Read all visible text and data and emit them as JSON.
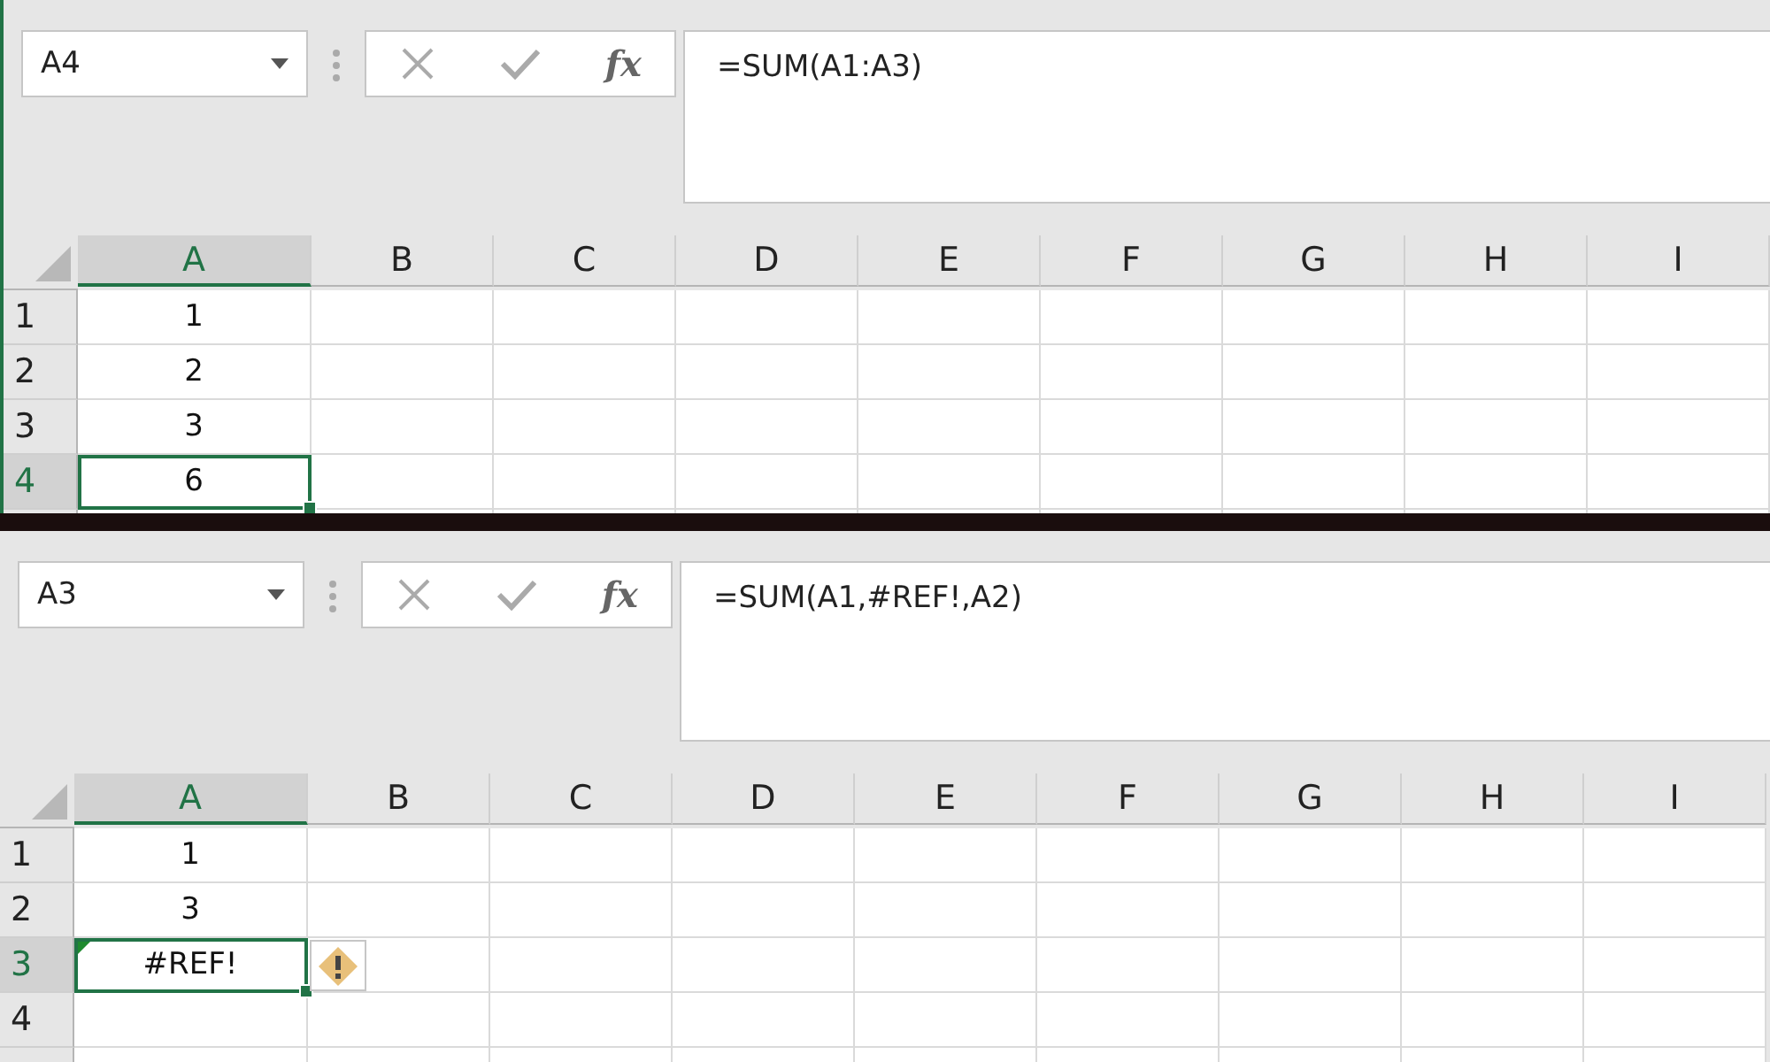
{
  "panels": [
    {
      "name_box": "A4",
      "fx_label": "fx",
      "formula": "=SUM(A1:A3)",
      "columns": [
        {
          "label": "A",
          "selected": true
        },
        {
          "label": "B",
          "selected": false
        },
        {
          "label": "C",
          "selected": false
        },
        {
          "label": "D",
          "selected": false
        },
        {
          "label": "E",
          "selected": false
        },
        {
          "label": "F",
          "selected": false
        },
        {
          "label": "G",
          "selected": false
        },
        {
          "label": "H",
          "selected": false
        },
        {
          "label": "I",
          "selected": false
        }
      ],
      "rows": [
        {
          "header": "1",
          "selected": false,
          "cells": [
            {
              "text": "1",
              "selected": false,
              "error": false
            }
          ]
        },
        {
          "header": "2",
          "selected": false,
          "cells": [
            {
              "text": "2",
              "selected": false,
              "error": false
            }
          ]
        },
        {
          "header": "3",
          "selected": false,
          "cells": [
            {
              "text": "3",
              "selected": false,
              "error": false
            }
          ]
        },
        {
          "header": "4",
          "selected": true,
          "cells": [
            {
              "text": "6",
              "selected": true,
              "error": false
            }
          ]
        }
      ]
    },
    {
      "name_box": "A3",
      "fx_label": "fx",
      "formula": "=SUM(A1,#REF!,A2)",
      "columns": [
        {
          "label": "A",
          "selected": true
        },
        {
          "label": "B",
          "selected": false
        },
        {
          "label": "C",
          "selected": false
        },
        {
          "label": "D",
          "selected": false
        },
        {
          "label": "E",
          "selected": false
        },
        {
          "label": "F",
          "selected": false
        },
        {
          "label": "G",
          "selected": false
        },
        {
          "label": "H",
          "selected": false
        },
        {
          "label": "I",
          "selected": false
        }
      ],
      "rows": [
        {
          "header": "1",
          "selected": false,
          "cells": [
            {
              "text": "1",
              "selected": false,
              "error": false
            }
          ]
        },
        {
          "header": "2",
          "selected": false,
          "cells": [
            {
              "text": "3",
              "selected": false,
              "error": false
            }
          ]
        },
        {
          "header": "3",
          "selected": true,
          "cells": [
            {
              "text": "#REF!",
              "selected": true,
              "error": true
            }
          ]
        },
        {
          "header": "4",
          "selected": false,
          "cells": []
        }
      ]
    }
  ]
}
